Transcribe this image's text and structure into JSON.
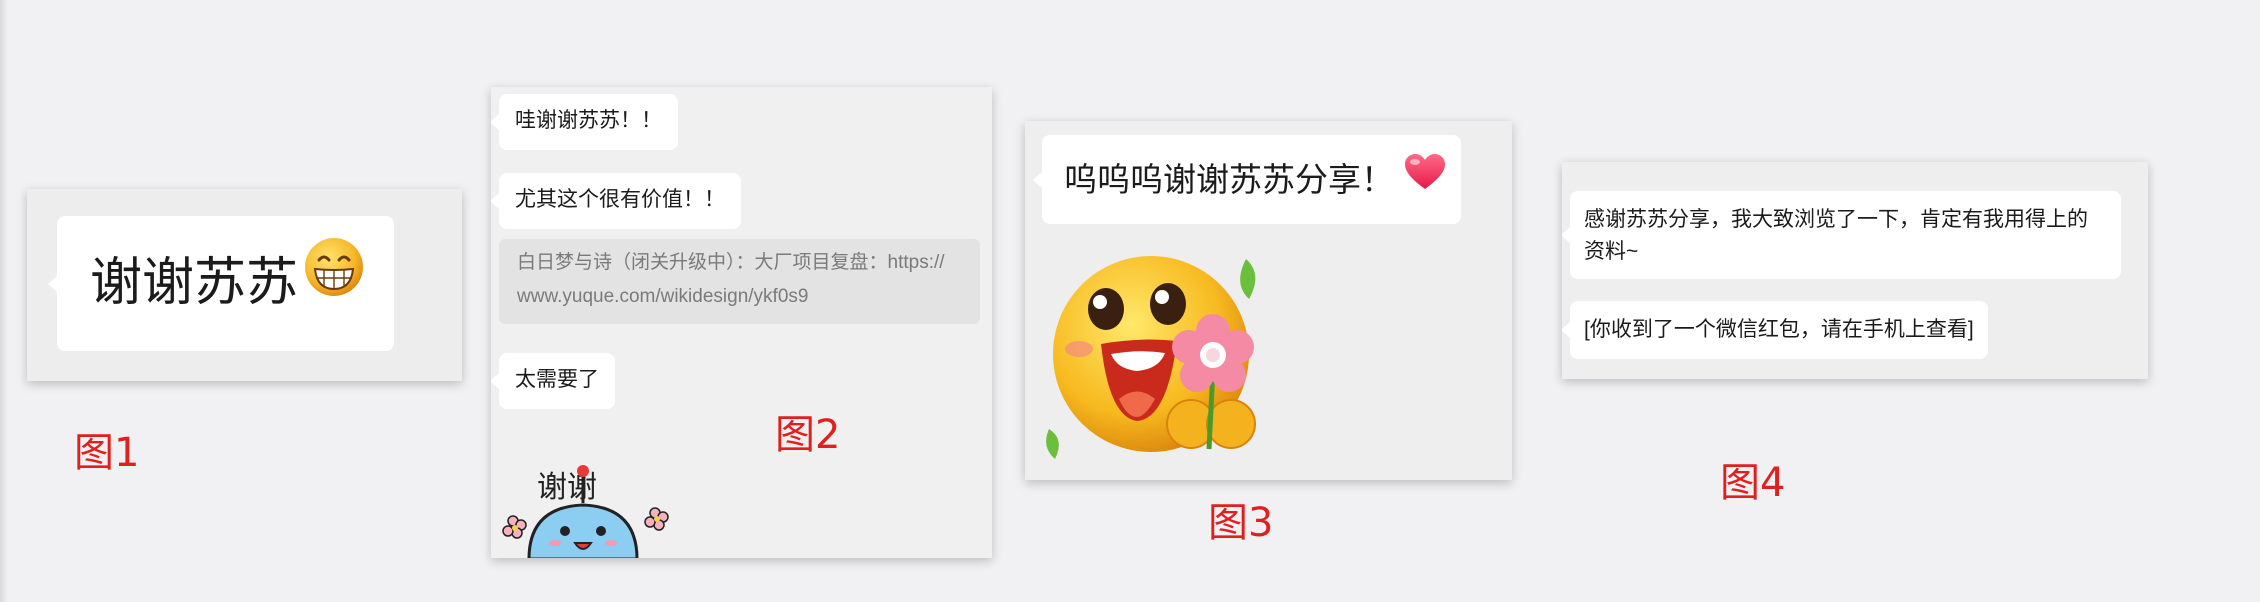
{
  "panels": [
    {
      "id": "fig1",
      "caption": "图1",
      "message": "谢谢苏苏",
      "emoji": "grinning-face-emoji"
    },
    {
      "id": "fig2",
      "caption": "图2",
      "messages": [
        "哇谢谢苏苏！！",
        "尤其这个很有价值！！",
        "太需要了"
      ],
      "quote": {
        "line1": "白日梦与诗（闭关升级中）：大厂项目复盘：https://",
        "line2": "www.yuque.com/wikidesign/ykf0s9"
      },
      "sticker": {
        "text": "谢谢",
        "icon": "blue-robot-thanks-sticker"
      }
    },
    {
      "id": "fig3",
      "caption": "图3",
      "message": "呜呜呜谢谢苏苏分享！",
      "emoji": "heart-emoji",
      "sticker": "smiley-with-flower-sticker"
    },
    {
      "id": "fig4",
      "caption": "图4",
      "messages": [
        "感谢苏苏分享，我大致浏览了一下，肯定有我用得上的资料~",
        "[你收到了一个微信红包，请在手机上查看]"
      ]
    }
  ],
  "colors": {
    "background": "#f1f1f3",
    "panel": "#ededed",
    "bubble": "#ffffff",
    "caption": "#e0201f",
    "quote_bg": "#e3e3e3",
    "quote_text": "#7a7a7a"
  }
}
